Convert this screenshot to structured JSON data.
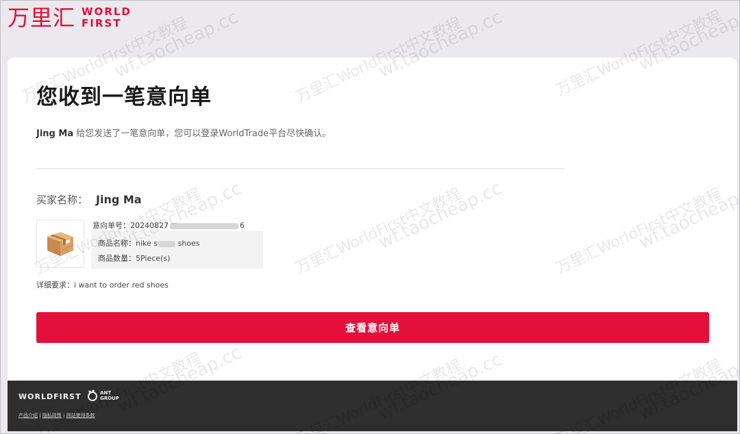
{
  "header": {
    "logo_cn": "万里汇",
    "logo_en_line1": "WORLD",
    "logo_en_line2": "FIRST"
  },
  "main": {
    "title": "您收到一笔意向单",
    "intro_sender": "Jing Ma",
    "intro_text": " 给您发送了一笔意向单，您可以登录WorldTrade平台尽快确认。",
    "buyer_label": "买家名称：",
    "buyer_name": "Jing Ma",
    "order_no_label": "意向单号：",
    "order_no_prefix": "20240827",
    "order_no_suffix": "6",
    "product_name_label": "商品名称：",
    "product_name_prefix": "nike s",
    "product_name_suffix": " shoes",
    "product_qty_label": "商品数量：",
    "product_qty": "5Piece(s)",
    "detail_label": "详细要求：",
    "detail_text": "i want to order red shoes",
    "cta_label": "查看意向单"
  },
  "footer": {
    "brand": "WORLDFIRST",
    "ant_line1": "ANT",
    "ant_line2": "GROUP",
    "links": [
      "产品介绍",
      "隐私政策",
      "网站使用条款"
    ],
    "separator": " | "
  },
  "watermark": {
    "text1": "万里汇WorldFirst中文教程",
    "text2": "wf.taocheap.cc"
  },
  "colors": {
    "brand_red": "#e2103a",
    "footer_bg": "#2e2e2e"
  }
}
